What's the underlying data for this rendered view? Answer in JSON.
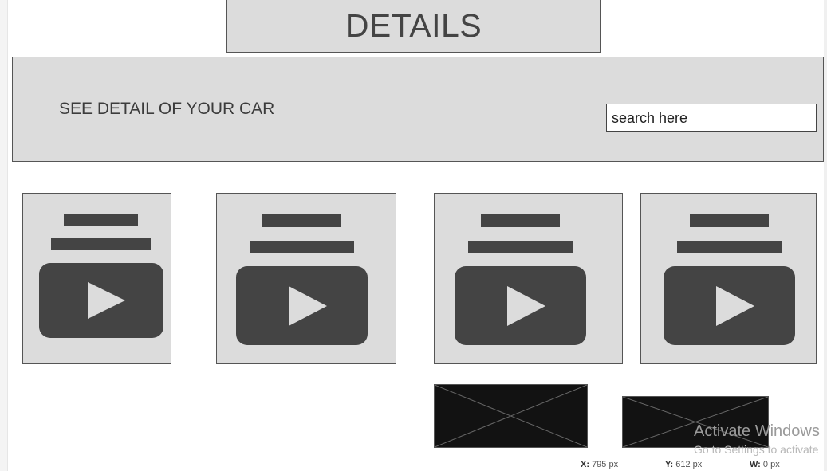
{
  "title": "DETAILS",
  "header": {
    "label": "SEE DETAIL OF YOUR CAR",
    "search_placeholder": "search here"
  },
  "cards": [
    {
      "icon": "video-icon"
    },
    {
      "icon": "video-icon"
    },
    {
      "icon": "video-icon"
    },
    {
      "icon": "video-icon"
    }
  ],
  "images": [
    {
      "icon": "image-placeholder-icon"
    },
    {
      "icon": "image-placeholder-icon"
    }
  ],
  "watermark": {
    "title": "Activate Windows",
    "subtitle": "Go to Settings to activate"
  },
  "status": {
    "x_label": "X:",
    "x_value": "795 px",
    "y_label": "Y:",
    "y_value": "612 px",
    "w_label": "W:",
    "w_value": "0 px"
  },
  "colors": {
    "panel": "#dcdcdc",
    "border": "#555555",
    "icon": "#444444",
    "image_fill": "#121212"
  }
}
